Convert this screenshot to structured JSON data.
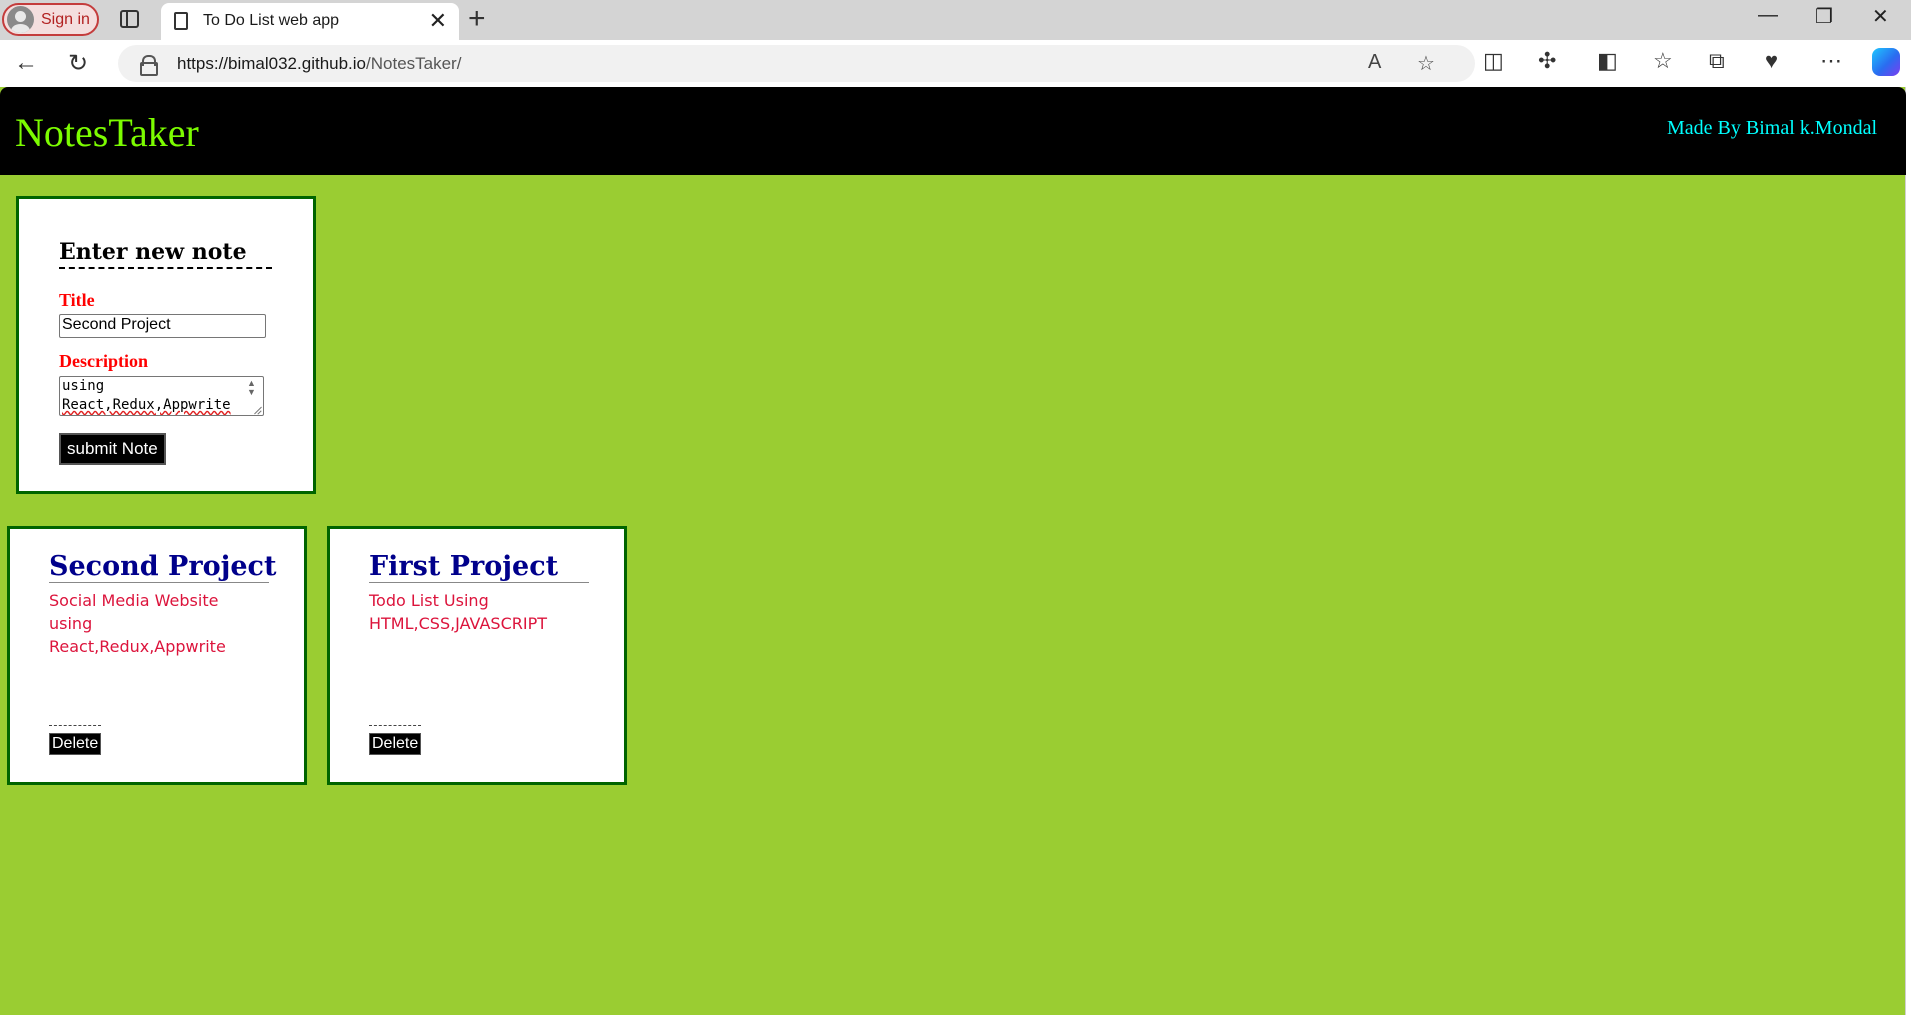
{
  "browser": {
    "signin_label": "Sign in",
    "tab_title": "To Do List web app",
    "tab_close": "✕",
    "new_tab": "+",
    "url_host": "https://bimal032.github.io",
    "url_path": "/NotesTaker/",
    "window_controls": {
      "minimize": "—",
      "restore": "❐",
      "close": "✕"
    }
  },
  "header": {
    "brand": "NotesTaker",
    "credit": "Made By Bimal k.Mondal"
  },
  "form": {
    "heading": "Enter new note",
    "title_label": "Title",
    "title_value": "Second Project",
    "description_label": "Description",
    "description_line1": "using",
    "description_line2": "React,Redux,Appwrite",
    "submit_label": "submit Note"
  },
  "notes": [
    {
      "title": "Second Project",
      "description": "Social Media Website using React,Redux,Appwrite",
      "delete_label": "Delete"
    },
    {
      "title": "First Project",
      "description": "Todo List Using HTML,CSS,JAVASCRIPT",
      "delete_label": "Delete"
    }
  ],
  "colors": {
    "page_background": "#9acd32",
    "header_background": "#000000",
    "brand": "#7cfc00",
    "credit": "#00ffff",
    "card_border": "#006400",
    "label_red": "#ff0000",
    "note_title": "#00008b",
    "note_desc": "#dc143c"
  },
  "icons": {
    "back": "arrow-left-icon",
    "refresh": "refresh-icon",
    "lock": "lock-icon",
    "read_aloud": "read-aloud-icon",
    "favorite": "star-icon",
    "extensions": "puzzle-icon",
    "split": "split-screen-icon",
    "favorites": "favorites-icon",
    "collections": "collections-icon",
    "health": "browser-essentials-icon",
    "more": "more-icon",
    "copilot": "copilot-icon"
  }
}
